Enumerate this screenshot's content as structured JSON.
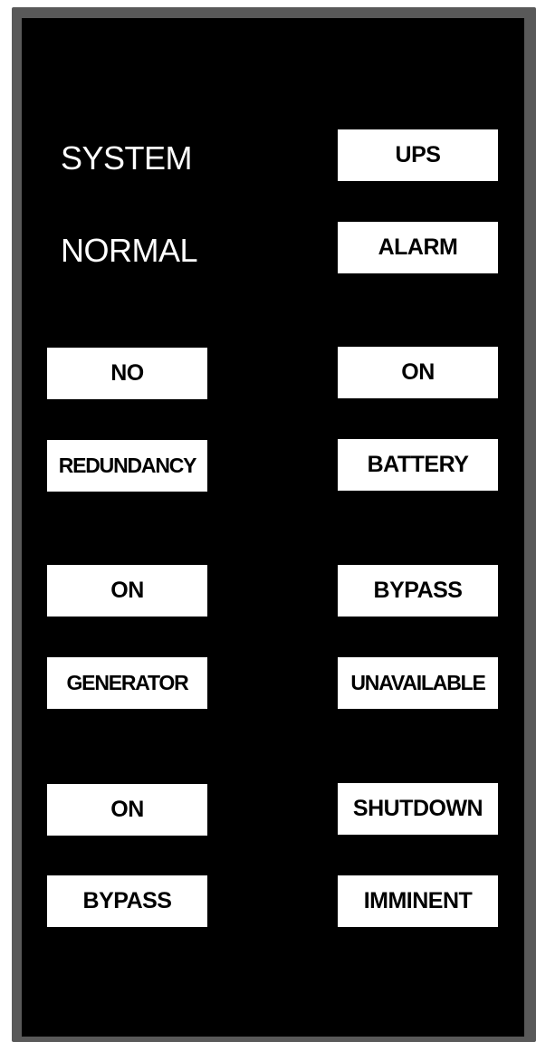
{
  "panel": {
    "status": {
      "line1": "SYSTEM",
      "line2": "NORMAL"
    },
    "indicators": [
      {
        "key": "ups-alarm",
        "top": "UPS",
        "bottom": "ALARM"
      },
      {
        "key": "no-redundancy",
        "top": "NO",
        "bottom": "REDUNDANCY"
      },
      {
        "key": "on-battery",
        "top": "ON",
        "bottom": "BATTERY"
      },
      {
        "key": "on-generator",
        "top": "ON",
        "bottom": "GENERATOR"
      },
      {
        "key": "bypass-unavailable",
        "top": "BYPASS",
        "bottom": "UNAVAILABLE"
      },
      {
        "key": "on-bypass",
        "top": "ON",
        "bottom": "BYPASS"
      },
      {
        "key": "shutdown-imminent",
        "top": "SHUTDOWN",
        "bottom": "IMMINENT"
      }
    ]
  }
}
